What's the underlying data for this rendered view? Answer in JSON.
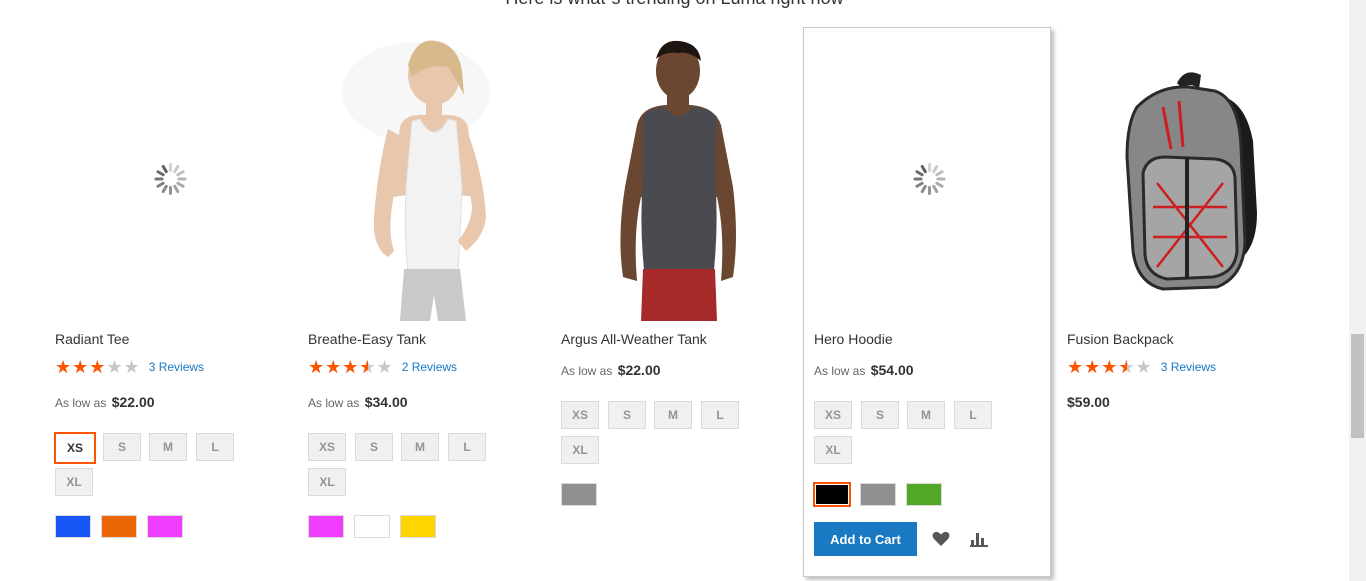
{
  "section": {
    "heading": "Here is what`s trending on Luma right now"
  },
  "products": [
    {
      "name": "Radiant Tee",
      "rating_percent": 60,
      "reviews": "3 Reviews",
      "price_prefix": "As low as",
      "price": "$22.00",
      "image": "loading-spinner",
      "sizes": [
        "XS",
        "S",
        "M",
        "L",
        "XL"
      ],
      "selected_size": "XS",
      "colors": [
        "#1857f7",
        "#eb6703",
        "#ef3dff"
      ],
      "selected_color": null
    },
    {
      "name": "Breathe-Easy Tank",
      "rating_percent": 70,
      "reviews": "2 Reviews",
      "price_prefix": "As low as",
      "price": "$34.00",
      "image": "woman-white-tank",
      "sizes": [
        "XS",
        "S",
        "M",
        "L",
        "XL"
      ],
      "selected_size": null,
      "colors": [
        "#ef3dff",
        "#ffffff",
        "#ffd500"
      ],
      "selected_color": null
    },
    {
      "name": "Argus All-Weather Tank",
      "rating_percent": null,
      "reviews": "",
      "price_prefix": "As low as",
      "price": "$22.00",
      "image": "man-gray-tank",
      "sizes": [
        "XS",
        "S",
        "M",
        "L",
        "XL"
      ],
      "selected_size": null,
      "colors": [
        "#8f8f8f"
      ],
      "selected_color": null
    },
    {
      "name": "Hero Hoodie",
      "rating_percent": null,
      "reviews": "",
      "price_prefix": "As low as",
      "price": "$54.00",
      "image": "loading-spinner",
      "sizes": [
        "XS",
        "S",
        "M",
        "L",
        "XL"
      ],
      "selected_size": null,
      "colors": [
        "#000000",
        "#8f8f8f",
        "#53a828"
      ],
      "selected_color": "#000000",
      "hovered": true,
      "add_to_cart": "Add to Cart"
    },
    {
      "name": "Fusion Backpack",
      "rating_percent": 70,
      "reviews": "3 Reviews",
      "price_prefix": "",
      "price": "$59.00",
      "image": "gray-backpack",
      "sizes": [],
      "selected_size": null,
      "colors": [],
      "selected_color": null
    }
  ],
  "icons": {
    "wishlist": "heart-icon",
    "compare": "bar-chart-icon",
    "rating": "star-icon"
  },
  "colors": {
    "accent": "#1979c3",
    "star": "#ff5501",
    "selected_border": "#ff5501"
  }
}
